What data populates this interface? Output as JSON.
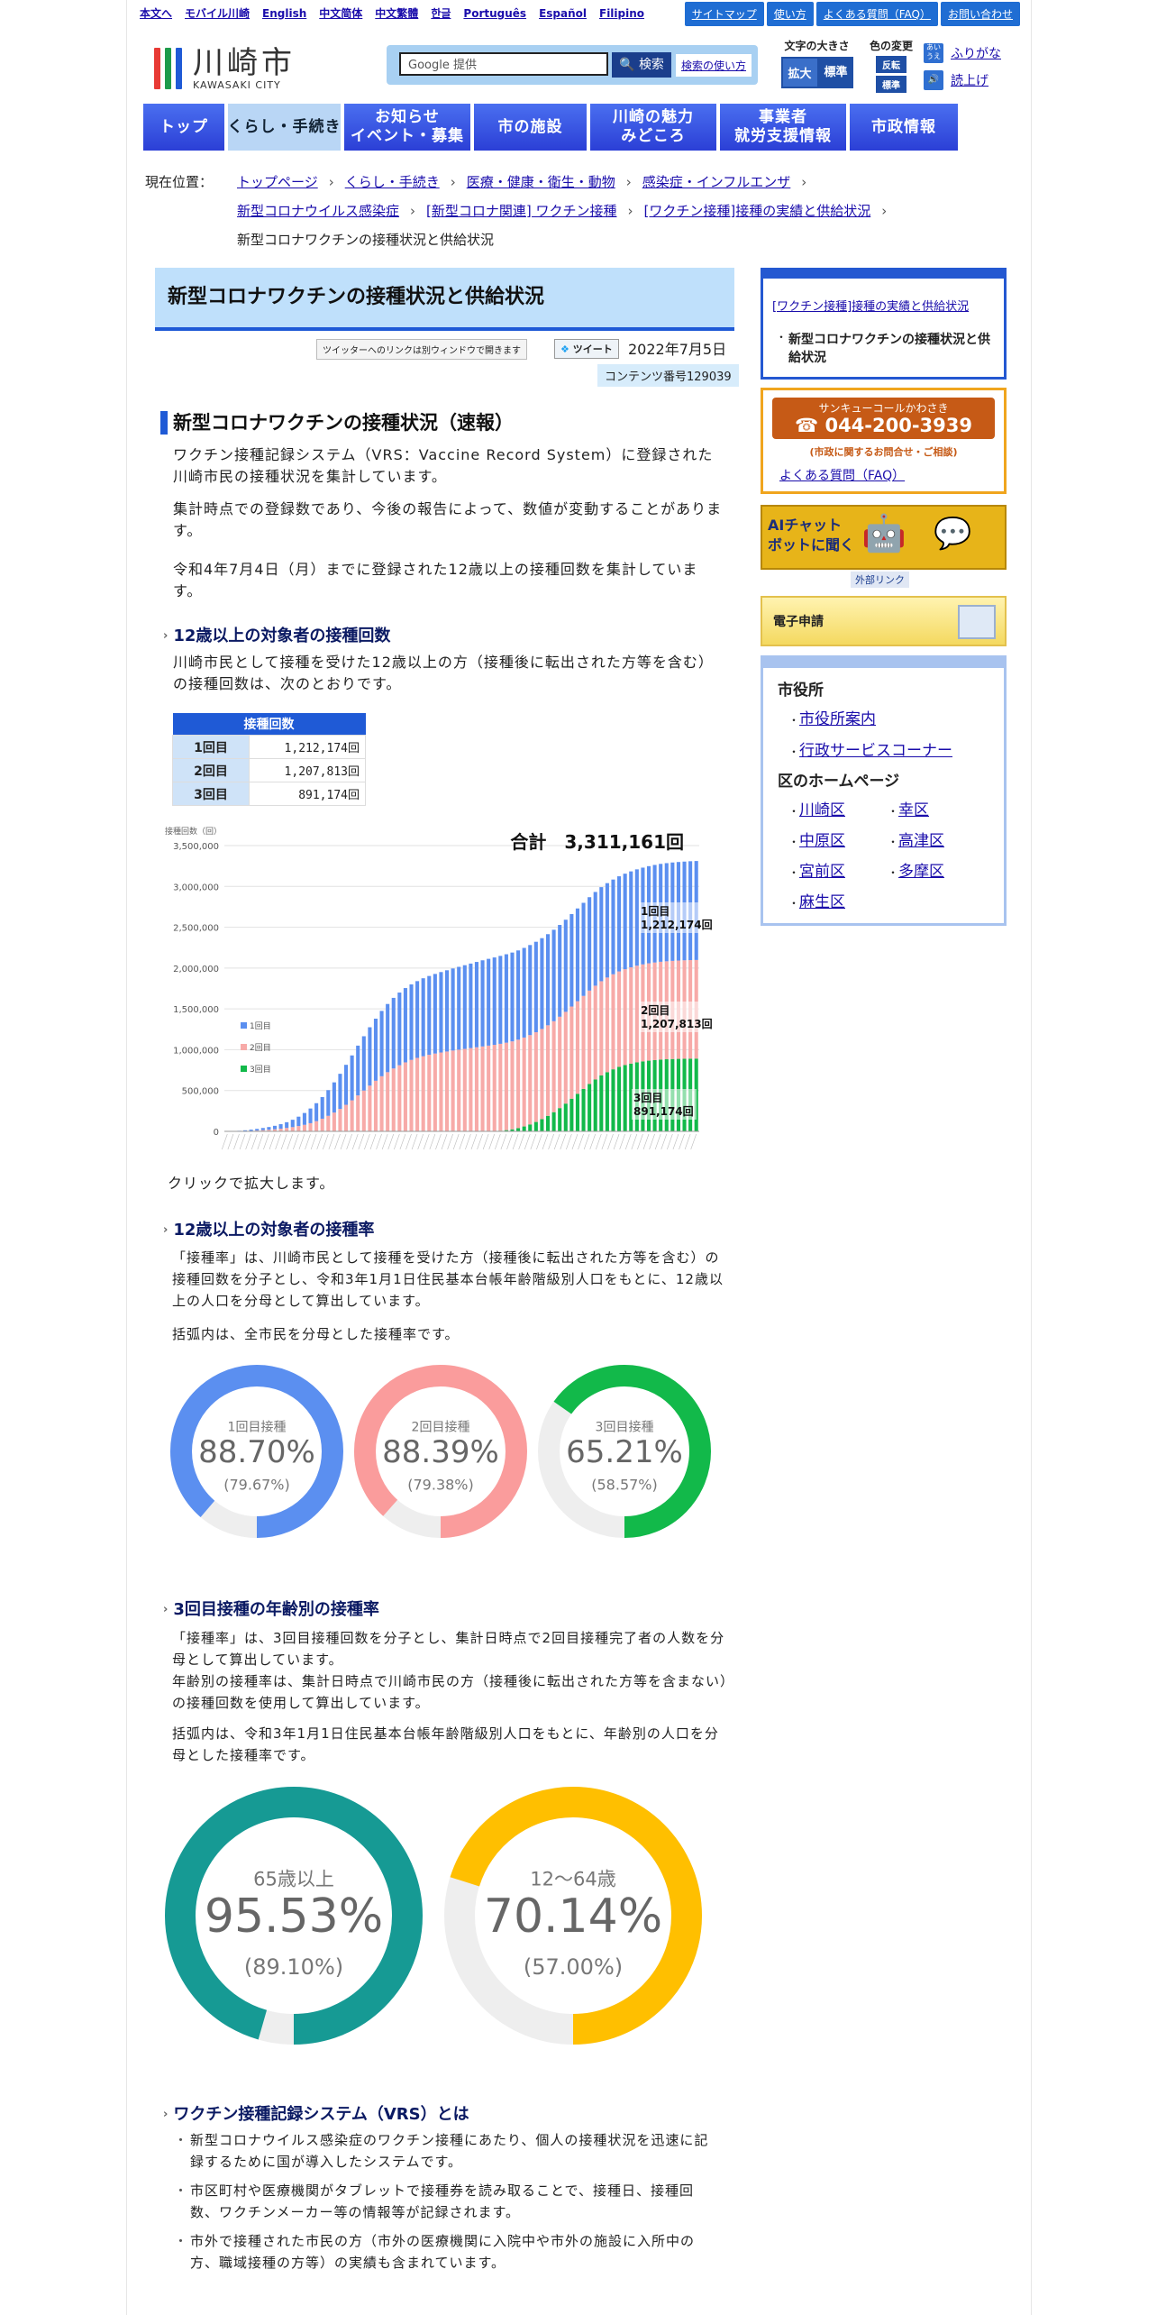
{
  "util": {
    "links": [
      "本文へ",
      "モバイル川崎",
      "English",
      "中文简体",
      "中文繁體",
      "한글",
      "Português",
      "Español",
      "Filipino"
    ],
    "right": [
      "サイトマップ",
      "使い方",
      "よくある質問（FAQ）",
      "お問い合わせ"
    ]
  },
  "header": {
    "logo_jp": "川崎市",
    "logo_en": "KAWASAKI CITY",
    "search_placeholder": "Google 提供",
    "search_btn": "検索",
    "search_help": "検索の使い方",
    "fontsize_label": "文字の大きさ",
    "fontsize_large": "拡大",
    "fontsize_std": "標準",
    "color_label": "色の変更",
    "color_invert": "反転",
    "color_std": "標準",
    "furigana": "ふりがな",
    "yomiage": "読上げ",
    "furigana_icon": "あい\nうえ"
  },
  "nav": [
    "トップ",
    "くらし・手続き",
    "お知らせ\nイベント・募集",
    "市の施設",
    "川崎の魅力\nみどころ",
    "事業者\n就労支援情報",
    "市政情報"
  ],
  "breadcrumb": {
    "label": "現在位置：",
    "items": [
      "トップページ",
      "くらし・手続き",
      "医療・健康・衛生・動物",
      "感染症・インフルエンザ",
      "新型コロナウイルス感染症",
      "[新型コロナ関連] ワクチン接種",
      "[ワクチン接種]接種の実績と供給状況"
    ],
    "current": "新型コロナワクチンの接種状況と供給状況"
  },
  "main": {
    "title": "新型コロナワクチンの接種状況と供給状況",
    "twitter_note": "ツイッターへのリンクは別ウィンドウで開きます",
    "tweet": "ツイート",
    "date": "2022年7月5日",
    "content_no": "コンテンツ番号129039",
    "h2": "新型コロナワクチンの接種状況（速報）",
    "p1": "ワクチン接種記録システム（VRS：Vaccine Record System）に登録された川崎市民の接種状況を集計しています。",
    "p2": "集計時点での登録数であり、今後の報告によって、数値が変動することがあります。",
    "p3": "令和4年7月4日（月）までに登録された12歳以上の接種回数を集計しています。",
    "h3a": "12歳以上の対象者の接種回数",
    "p4": "川崎市民として接種を受けた12歳以上の方（接種後に転出された方等を含む）の接種回数は、次のとおりです。",
    "table": {
      "header": "接種回数",
      "rows": [
        {
          "k": "1回目",
          "v": "1,212,174回"
        },
        {
          "k": "2回目",
          "v": "1,207,813回"
        },
        {
          "k": "3回目",
          "v": "891,174回"
        }
      ]
    },
    "click_note": "クリックで拡大します。",
    "h3b": "12歳以上の対象者の接種率",
    "p5": "「接種率」は、川崎市民として接種を受けた方（接種後に転出された方等を含む）の接種回数を分子とし、令和3年1月1日住民基本台帳年齢階級別人口をもとに、12歳以上の人口を分母として算出しています。",
    "p6": "括弧内は、全市民を分母とした接種率です。",
    "h3c": "3回目接種の年齢別の接種率",
    "p7": "「接種率」は、3回目接種回数を分子とし、集計日時点で2回目接種完了者の人数を分母として算出しています。",
    "p8": "年齢別の接種率は、集計日時点で川崎市民の方（接種後に転出された方等を含まない）の接種回数を使用して算出しています。",
    "p9": "括弧内は、令和3年1月1日住民基本台帳年齢階級別人口をもとに、年齢別の人口を分母とした接種率です。",
    "h3d": "ワクチン接種記録システム（VRS）とは",
    "b1": "新型コロナウイルス感染症のワクチン接種にあたり、個人の接種状況を迅速に記録するために国が導入したシステムです。",
    "b2": "市区町村や医療機関がタブレットで接種券を読み取ることで、接種日、接種回数、ワクチンメーカー等の情報等が記録されます。",
    "b3": "市外で接種された市民の方（市外の医療機関に入院中や市外の施設に入所中の方、職域接種の方等）の実績も含まれています。"
  },
  "donuts": [
    {
      "label": "1回目接種",
      "pct": "88.70%",
      "sub": "(79.67%)",
      "value": 88.7,
      "color": "#5b8ff0"
    },
    {
      "label": "2回目接種",
      "pct": "88.39%",
      "sub": "(79.38%)",
      "value": 88.39,
      "color": "#fa9c9c"
    },
    {
      "label": "3回目接種",
      "pct": "65.21%",
      "sub": "(58.57%)",
      "value": 65.21,
      "color": "#12b94a"
    }
  ],
  "donuts2": [
    {
      "label": "65歳以上",
      "pct": "95.53%",
      "sub": "(89.10%)",
      "value": 95.53,
      "color": "#169a94"
    },
    {
      "label": "12〜64歳",
      "pct": "70.14%",
      "sub": "(57.00%)",
      "value": 70.14,
      "color": "#ffbf00"
    }
  ],
  "chart_data": {
    "type": "bar",
    "title": "合計　3,311,161回",
    "ylabel": "接種回数（回）",
    "ylim": [
      0,
      3500000
    ],
    "yticks": [
      "3,500,000",
      "3,000,000",
      "2,500,000",
      "2,000,000",
      "1,500,000",
      "1,000,000",
      "500,000",
      "0"
    ],
    "legend": [
      "1回目",
      "2回目",
      "3回目"
    ],
    "annotations": [
      {
        "label": "1回目",
        "value": "1,212,174回"
      },
      {
        "label": "2回目",
        "value": "1,207,813回"
      },
      {
        "label": "3回目",
        "value": "891,174回"
      }
    ],
    "colors": [
      "#5b8ff0",
      "#f7aaa8",
      "#12b94a"
    ],
    "series": [
      {
        "name": "1回目",
        "values": [
          1000,
          3000,
          6000,
          10000,
          15000,
          20000,
          26000,
          33000,
          42000,
          55000,
          70000,
          90000,
          115000,
          145000,
          180000,
          220000,
          265000,
          315000,
          370000,
          430000,
          490000,
          550000,
          610000,
          665000,
          715000,
          760000,
          800000,
          835000,
          865000,
          890000,
          910000,
          925000,
          940000,
          955000,
          965000,
          975000,
          985000,
          995000,
          1005000,
          1015000,
          1025000,
          1035000,
          1045000,
          1055000,
          1063000,
          1070000,
          1077000,
          1083000,
          1088000,
          1093000,
          1098000,
          1103000,
          1108000,
          1112000,
          1116000,
          1120000,
          1124000,
          1128000,
          1132000,
          1136000,
          1140000,
          1144000,
          1148000,
          1152000,
          1156000,
          1160000,
          1165000,
          1170000,
          1175000,
          1180000,
          1185000,
          1190000,
          1195000,
          1199000,
          1202000,
          1205000,
          1207000,
          1209000,
          1211000,
          1212174
        ]
      },
      {
        "name": "2回目",
        "values": [
          0,
          0,
          1000,
          3000,
          6000,
          10000,
          15000,
          20000,
          26000,
          33000,
          42000,
          52000,
          65000,
          80000,
          100000,
          125000,
          155000,
          190000,
          230000,
          275000,
          325000,
          380000,
          440000,
          500000,
          560000,
          620000,
          675000,
          725000,
          770000,
          810000,
          845000,
          875000,
          900000,
          920000,
          938000,
          953000,
          966000,
          978000,
          990000,
          1000000,
          1010000,
          1020000,
          1030000,
          1040000,
          1049000,
          1057000,
          1064000,
          1071000,
          1077000,
          1083000,
          1089000,
          1094000,
          1099000,
          1104000,
          1109000,
          1114000,
          1119000,
          1124000,
          1129000,
          1134000,
          1139000,
          1144000,
          1149000,
          1154000,
          1159000,
          1164000,
          1169000,
          1174000,
          1179000,
          1184000,
          1188000,
          1192000,
          1195000,
          1198000,
          1200000,
          1202000,
          1204000,
          1205500,
          1207000,
          1207813
        ]
      },
      {
        "name": "3回目",
        "values": [
          0,
          0,
          0,
          0,
          0,
          0,
          0,
          0,
          0,
          0,
          0,
          0,
          0,
          0,
          0,
          0,
          0,
          0,
          0,
          0,
          0,
          0,
          0,
          0,
          0,
          0,
          0,
          0,
          0,
          0,
          0,
          0,
          0,
          0,
          0,
          0,
          0,
          0,
          0,
          0,
          0,
          0,
          0,
          0,
          1000,
          3000,
          8000,
          15000,
          25000,
          40000,
          60000,
          85000,
          115000,
          150000,
          190000,
          235000,
          285000,
          340000,
          400000,
          460000,
          520000,
          580000,
          635000,
          685000,
          725000,
          760000,
          790000,
          812000,
          830000,
          845000,
          857000,
          866000,
          873000,
          879000,
          883000,
          886000,
          888000,
          889500,
          890500,
          891174
        ]
      }
    ]
  },
  "side": {
    "s1_link": "[ワクチン接種]接種の実績と供給状況",
    "s1_current": "新型コロナワクチンの接種状況と供給状況",
    "s2_small": "サンキューコールかわさき",
    "s2_tel": "044-200-3939",
    "s2_note": "(市政に関するお問合せ・ご相談)",
    "s2_faq": "よくある質問（FAQ）",
    "s3": "AIチャット\nボットに聞く",
    "s3_ext": "外部リンク",
    "s4": "電子申請",
    "s5_h1": "市役所",
    "s5_l1": [
      "市役所案内",
      "行政サービスコーナー"
    ],
    "s5_h2": "区のホームページ",
    "s5_wards": [
      "川崎区",
      "幸区",
      "中原区",
      "高津区",
      "宮前区",
      "多摩区",
      "麻生区"
    ]
  }
}
